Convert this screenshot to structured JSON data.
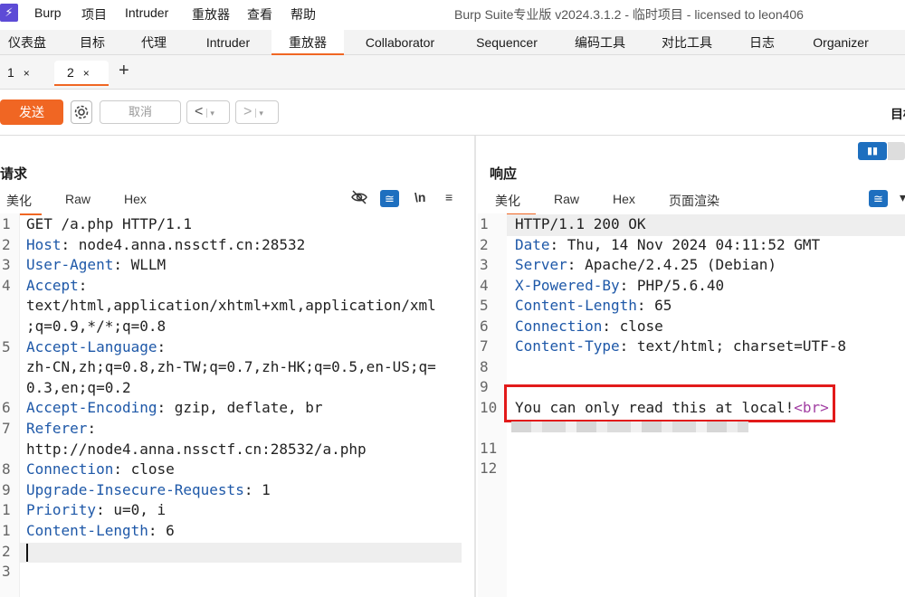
{
  "menubar": {
    "logo_glyph": "⚡",
    "items": [
      "Burp",
      "项目",
      "Intruder",
      "重放器",
      "查看",
      "帮助"
    ],
    "title": "Burp Suite专业版  v2024.3.1.2 - 临时项目 - licensed to leon406"
  },
  "main_tabs": [
    "仪表盘",
    "目标",
    "代理",
    "Intruder",
    "重放器",
    "Collaborator",
    "Sequencer",
    "编码工具",
    "对比工具",
    "日志",
    "Organizer"
  ],
  "main_tab_active": "重放器",
  "repeater_tabs": [
    {
      "label": "1",
      "close": "×"
    },
    {
      "label": "2",
      "close": "×",
      "active": true
    }
  ],
  "add_tab_glyph": "+",
  "toolbar": {
    "send_label": "发送",
    "settings_icon": "gear-icon",
    "cancel_label": "取消",
    "back_glyph": "<",
    "forward_glyph": ">",
    "dropdown_glyph": "▾",
    "target_label": "目标"
  },
  "request": {
    "title": "请求",
    "view_tabs": [
      "美化",
      "Raw",
      "Hex"
    ],
    "active_view": "美化",
    "icons": [
      "hide-icon",
      "wrap-icon",
      "newline-icon",
      "menu-icon"
    ],
    "newline_glyph": "\\n",
    "menu_glyph": "≡",
    "lines": [
      {
        "num": "1",
        "key": "",
        "rest": "GET /a.php HTTP/1.1"
      },
      {
        "num": "2",
        "key": "Host",
        "rest": ": node4.anna.nssctf.cn:28532"
      },
      {
        "num": "3",
        "key": "User-Agent",
        "rest": ": WLLM"
      },
      {
        "num": "4",
        "key": "Accept",
        "rest": ":"
      },
      {
        "num": "",
        "key": "",
        "rest": "text/html,application/xhtml+xml,application/xml"
      },
      {
        "num": "",
        "key": "",
        "rest": ";q=0.9,*/*;q=0.8"
      },
      {
        "num": "5",
        "key": "Accept-Language",
        "rest": ":"
      },
      {
        "num": "",
        "key": "",
        "rest": "zh-CN,zh;q=0.8,zh-TW;q=0.7,zh-HK;q=0.5,en-US;q="
      },
      {
        "num": "",
        "key": "",
        "rest": "0.3,en;q=0.2"
      },
      {
        "num": "6",
        "key": "Accept-Encoding",
        "rest": ": gzip, deflate, br"
      },
      {
        "num": "7",
        "key": "Referer",
        "rest": ":"
      },
      {
        "num": "",
        "key": "",
        "rest": "http://node4.anna.nssctf.cn:28532/a.php"
      },
      {
        "num": "8",
        "key": "Connection",
        "rest": ": close"
      },
      {
        "num": "9",
        "key": "Upgrade-Insecure-Requests",
        "rest": ": 1"
      },
      {
        "num": "1",
        "key": "Priority",
        "rest": ": u=0, i"
      },
      {
        "num": "1",
        "key": "Content-Length",
        "rest": ": 6"
      },
      {
        "num": "2",
        "key": "",
        "rest": ""
      },
      {
        "num": "3",
        "key": "",
        "rest": ""
      }
    ]
  },
  "response": {
    "title": "响应",
    "view_tabs": [
      "美化",
      "Raw",
      "Hex",
      "页面渲染"
    ],
    "active_view": "美化",
    "icons": [
      "wrap-icon",
      "menu-icon"
    ],
    "lines": [
      {
        "num": "1",
        "key": "",
        "rest": "HTTP/1.1 200 OK"
      },
      {
        "num": "2",
        "key": "Date",
        "rest": ": Thu, 14 Nov 2024 04:11:52 GMT"
      },
      {
        "num": "3",
        "key": "Server",
        "rest": ": Apache/2.4.25 (Debian)"
      },
      {
        "num": "4",
        "key": "X-Powered-By",
        "rest": ": PHP/5.6.40"
      },
      {
        "num": "5",
        "key": "Content-Length",
        "rest": ": 65"
      },
      {
        "num": "6",
        "key": "Connection",
        "rest": ": close"
      },
      {
        "num": "7",
        "key": "Content-Type",
        "rest": ": text/html; charset=UTF-8"
      },
      {
        "num": "8",
        "key": "",
        "rest": ""
      },
      {
        "num": "9",
        "key": "",
        "rest": ""
      },
      {
        "num": "10",
        "key": "",
        "rest": "You can only read this at local!",
        "tag": "<br>"
      },
      {
        "num": "",
        "key": "",
        "rest": ""
      },
      {
        "num": "11",
        "key": "",
        "rest": ""
      },
      {
        "num": "12",
        "key": "",
        "rest": ""
      }
    ]
  },
  "colors": {
    "accent": "#f06623",
    "header_key": "#1e58a8",
    "html_tag": "#a23fa3",
    "annotation": "#e21a1a",
    "toggle": "#1e6fbf"
  }
}
